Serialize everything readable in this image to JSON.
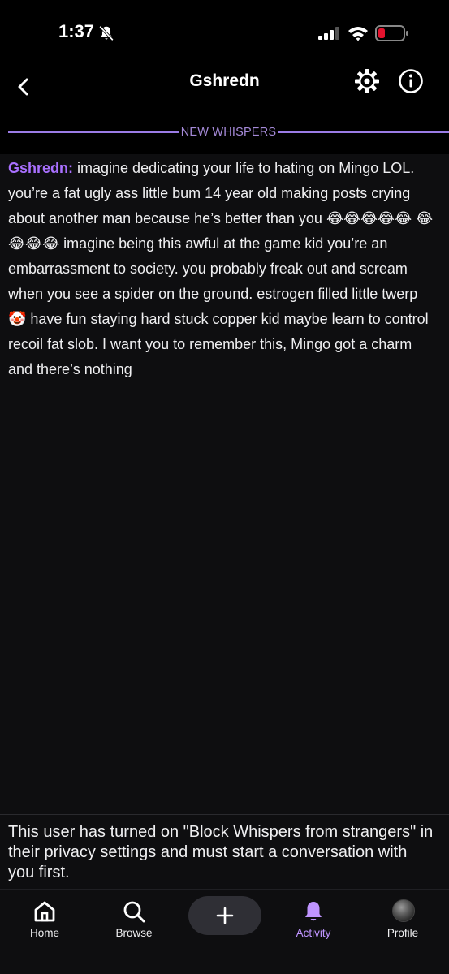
{
  "status_bar": {
    "time": "1:37"
  },
  "header": {
    "title": "Gshredn"
  },
  "divider": {
    "label": "NEW WHISPERS"
  },
  "message": {
    "author": "Gshredn:",
    "text": " imagine dedicating your life to hating on Mingo LOL. you’re a fat ugly ass little bum 14 year old making posts crying about another man because he’s better than you 😂😂😂😂😂 😂😂😂😂 imagine being this awful at the game kid you’re an embarrassment to society. you probably freak out and scream when you see a spider on the ground. estrogen filled little twerp 🤡 have fun staying hard stuck copper kid maybe learn to control recoil fat slob. I want you to remember this, Mingo got a charm and there’s nothing"
  },
  "notice": {
    "text": "This user has turned on \"Block Whispers from strangers\" in their privacy settings and must start a conversation with you first."
  },
  "nav": {
    "home": "Home",
    "browse": "Browse",
    "activity": "Activity",
    "profile": "Profile"
  },
  "colors": {
    "accent": "#a970ff",
    "background": "#0e0e10",
    "divider": "#9b7ce6",
    "battery_low": "#e5132e"
  },
  "icons": {
    "back": "chevron-left-icon",
    "settings": "gear-icon",
    "info": "info-icon",
    "home": "home-icon",
    "browse": "search-icon",
    "create": "plus-icon",
    "activity": "bell-icon",
    "profile": "avatar"
  }
}
